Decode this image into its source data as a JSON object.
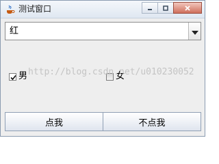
{
  "window": {
    "title": "测试窗口",
    "icons": {
      "app": "java-cup-icon",
      "minimize": "minimize-icon",
      "maximize": "maximize-icon",
      "close": "close-icon"
    },
    "close_color": "#c9543d"
  },
  "combo": {
    "selected": "红",
    "arrow_icon": "chevron-down-icon"
  },
  "checkboxes": [
    {
      "label": "男",
      "checked": true
    },
    {
      "label": "女",
      "checked": false
    }
  ],
  "buttons": {
    "click_me": "点我",
    "dont_click_me": "不点我"
  },
  "watermark": "http://blog.csdn.net/u010230052"
}
